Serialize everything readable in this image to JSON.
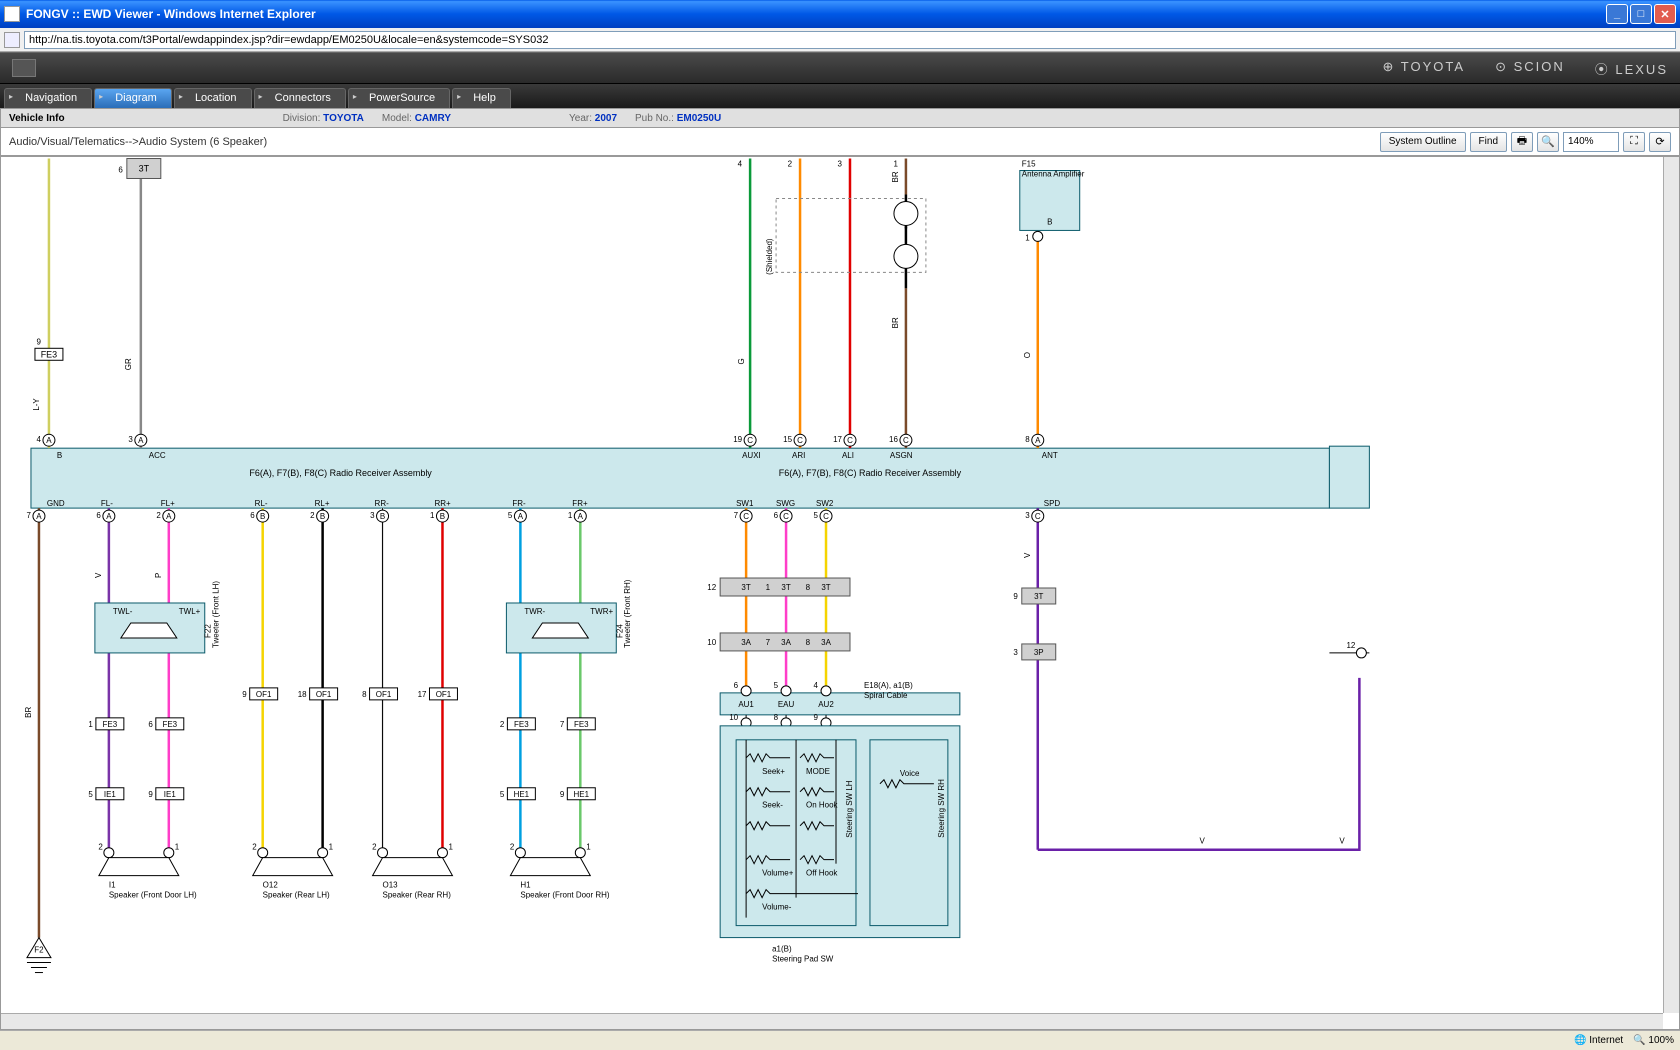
{
  "window": {
    "title": "FONGV :: EWD Viewer - Windows Internet Explorer"
  },
  "address": {
    "url": "http://na.tis.toyota.com/t3Portal/ewdappindex.jsp?dir=ewdapp/EM0250U&locale=en&systemcode=SYS032"
  },
  "brands": {
    "toyota": "⊕ TOYOTA",
    "scion": "⊙ SCION",
    "lexus": "⦿ LEXUS"
  },
  "tabs": {
    "navigation": "Navigation",
    "diagram": "Diagram",
    "location": "Location",
    "connectors": "Connectors",
    "powersource": "PowerSource",
    "help": "Help"
  },
  "vehicleinfo": {
    "title": "Vehicle Info",
    "division_lbl": "Division:",
    "division_val": "TOYOTA",
    "model_lbl": "Model:",
    "model_val": "CAMRY",
    "year_lbl": "Year:",
    "year_val": "2007",
    "pubno_lbl": "Pub No.:",
    "pubno_val": "EM0250U"
  },
  "breadcrumb": "Audio/Visual/Telematics-->Audio System (6 Speaker)",
  "toolbar": {
    "system_outline": "System Outline",
    "find": "Find",
    "zoom": "140%"
  },
  "diagram": {
    "radio_assy1": "F6(A), F7(B), F8(C)\nRadio Receiver Assembly",
    "radio_assy2": "F6(A), F7(B), F8(C)\nRadio Receiver Assembly",
    "antenna": {
      "id": "F15",
      "name": "Antenna Amplifier",
      "pin": "B"
    },
    "spiral": {
      "id": "E18(A), a1(B)",
      "name": "Spiral Cable"
    },
    "steering": {
      "id": "a1(B)",
      "name": "Steering Pad SW"
    },
    "tweeter_lh": {
      "id": "F22",
      "name": "Tweeter (Front LH)",
      "twl_minus": "TWL-",
      "twl_plus": "TWL+"
    },
    "tweeter_rh": {
      "id": "F24",
      "name": "Tweeter (Front RH)",
      "twr_minus": "TWR-",
      "twr_plus": "TWR+"
    },
    "speakers": {
      "front_lh": {
        "id": "I1",
        "name": "Speaker\n(Front Door LH)"
      },
      "rear_lh": {
        "id": "O12",
        "name": "Speaker\n(Rear LH)"
      },
      "rear_rh": {
        "id": "O13",
        "name": "Speaker\n(Rear RH)"
      },
      "front_rh": {
        "id": "H1",
        "name": "Speaker\n(Front Door RH)"
      }
    },
    "top_pins": {
      "p4": {
        "num": "4",
        "lbl": "B",
        "color": "L-Y"
      },
      "p3": {
        "num": "3",
        "lbl": "ACC",
        "color": "GR"
      },
      "p19": {
        "num": "19",
        "lbl": "AUXI",
        "color": "G"
      },
      "p15": {
        "num": "15",
        "lbl": "ARI",
        "color": "O"
      },
      "p17": {
        "num": "17",
        "lbl": "ALI",
        "color": "R"
      },
      "p16": {
        "num": "16",
        "lbl": "ASGN",
        "color": "BR"
      },
      "p8": {
        "num": "8",
        "lbl": "ANT",
        "color": "O"
      }
    },
    "bot_pins": {
      "gnd": {
        "num": "7",
        "lbl": "GND",
        "color": "BR"
      },
      "fl_minus": {
        "num": "6",
        "lbl": "FL-",
        "color": "V"
      },
      "fl_plus": {
        "num": "2",
        "lbl": "FL+",
        "color": "P"
      },
      "rl_minus": {
        "num": "6",
        "lbl": "RL-",
        "color": "Y"
      },
      "rl_plus": {
        "num": "2",
        "lbl": "RL+",
        "color": "B"
      },
      "rr_minus": {
        "num": "3",
        "lbl": "RR-",
        "color": "W"
      },
      "rr_plus": {
        "num": "1",
        "lbl": "RR+",
        "color": "R"
      },
      "fr_minus": {
        "num": "5",
        "lbl": "FR-",
        "color": "L"
      },
      "fr_plus": {
        "num": "1",
        "lbl": "FR+",
        "color": "LG"
      },
      "sw1": {
        "num": "7",
        "lbl": "SW1",
        "color": "O"
      },
      "swg": {
        "num": "6",
        "lbl": "SWG",
        "color": "P"
      },
      "sw2": {
        "num": "5",
        "lbl": "SW2",
        "color": "Y"
      },
      "spd": {
        "num": "3",
        "lbl": "SPD",
        "color": "V"
      }
    },
    "connectors": {
      "fe3": "FE3",
      "ie1": "IE1",
      "of1": "OF1",
      "he1": "HE1",
      "3t": "3T",
      "3a": "3A",
      "3p": "3P"
    },
    "spiral_pins": {
      "au1": "AU1",
      "eau": "EAU",
      "au2": "AU2"
    },
    "steering_btns": {
      "seek_plus": "Seek+",
      "mode": "MODE",
      "seek_minus": "Seek-",
      "on_hook": "On Hook",
      "vol_plus": "Volume+",
      "off_hook": "Off Hook",
      "vol_minus": "Volume-",
      "voice": "Voice",
      "lh": "Steering SW LH",
      "rh": "Steering SW RH"
    },
    "shielded": "(Shielded)",
    "ground": "F2"
  },
  "status": {
    "internet": "Internet",
    "zoom": "100%"
  }
}
